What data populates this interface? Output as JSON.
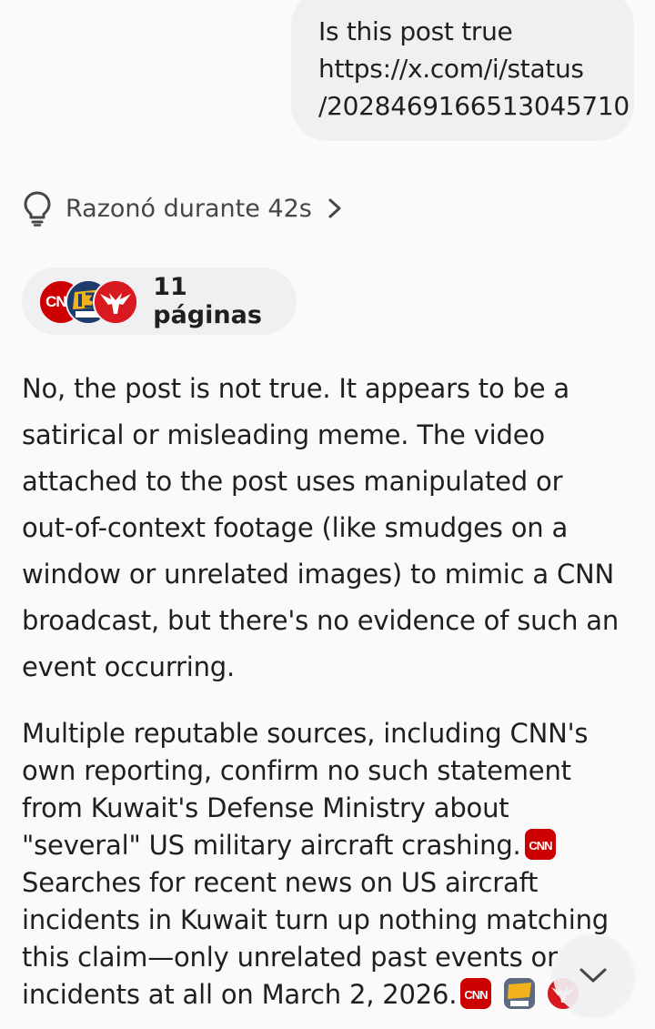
{
  "user_message": {
    "lines": [
      "Is this post true",
      "https://x.com/i/status",
      "/2028469166513045710"
    ]
  },
  "reasoning": {
    "label": "Razonó durante 42s",
    "icon": "lightbulb-icon",
    "chevron": "chevron-right-icon"
  },
  "sources": {
    "label": "11 páginas",
    "favicons": [
      "cnn-logo",
      "kado13-logo",
      "eagle-logo"
    ],
    "cnn_text": "CNN"
  },
  "answer": {
    "paragraph1_lines": [
      "No, the post is not true. It appears to be a",
      "satirical or misleading meme. The video",
      "attached to the post uses manipulated or",
      "out-of-context footage (like smudges on a",
      "window or unrelated images) to mimic a CNN",
      "broadcast, but there's no evidence of such an",
      "event occurring."
    ],
    "paragraph2_lines": [
      "Multiple reputable sources, including CNN's",
      "own reporting, confirm no such statement",
      "from Kuwait's Defense Ministry about",
      "\"several\" US military aircraft crashing.",
      "Searches for recent news on US aircraft",
      "incidents in Kuwait turn up nothing matching",
      "this claim—only unrelated past events or",
      "incidents at all on March 2, 2026."
    ]
  },
  "scroll_button": {
    "icon": "chevron-down-icon"
  },
  "colors": {
    "background": "#fafafa",
    "bubble": "#f0f0f2",
    "text": "#1f1f1f",
    "muted": "#444746",
    "cnn_red": "#cc0000"
  }
}
